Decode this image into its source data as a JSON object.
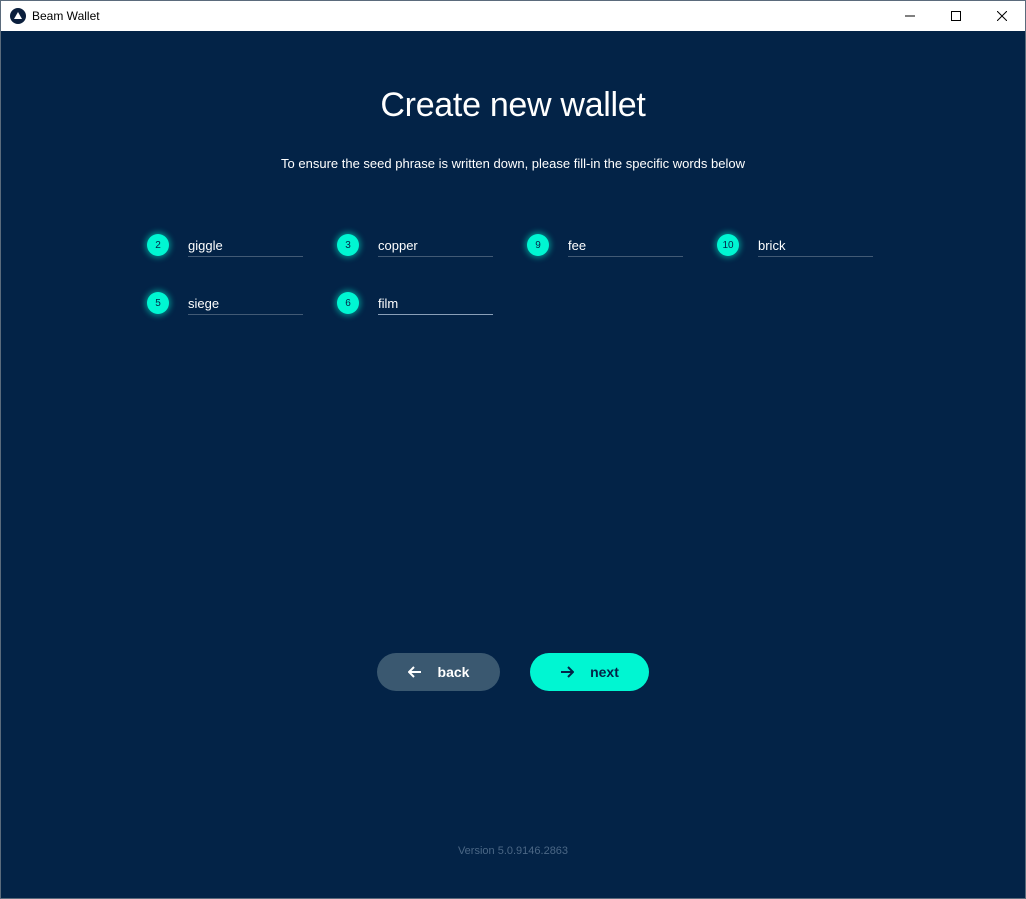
{
  "window": {
    "title": "Beam Wallet",
    "controls": {
      "minimize": "minimize",
      "maximize": "maximize",
      "close": "close"
    }
  },
  "page": {
    "title": "Create new wallet",
    "instruction": "To ensure the seed phrase is written down, please fill-in the specific words below"
  },
  "seed_words": [
    {
      "number": "2",
      "value": "giggle"
    },
    {
      "number": "3",
      "value": "copper"
    },
    {
      "number": "9",
      "value": "fee"
    },
    {
      "number": "10",
      "value": "brick"
    },
    {
      "number": "5",
      "value": "siege"
    },
    {
      "number": "6",
      "value": "film"
    }
  ],
  "buttons": {
    "back_label": "back",
    "next_label": "next"
  },
  "footer": {
    "version": "Version 5.0.9146.2863"
  },
  "colors": {
    "background": "#032347",
    "accent": "#00f6d2",
    "back_button": "#3a5870"
  },
  "icons": {
    "back": "arrow-left-icon",
    "next": "arrow-right-icon"
  }
}
